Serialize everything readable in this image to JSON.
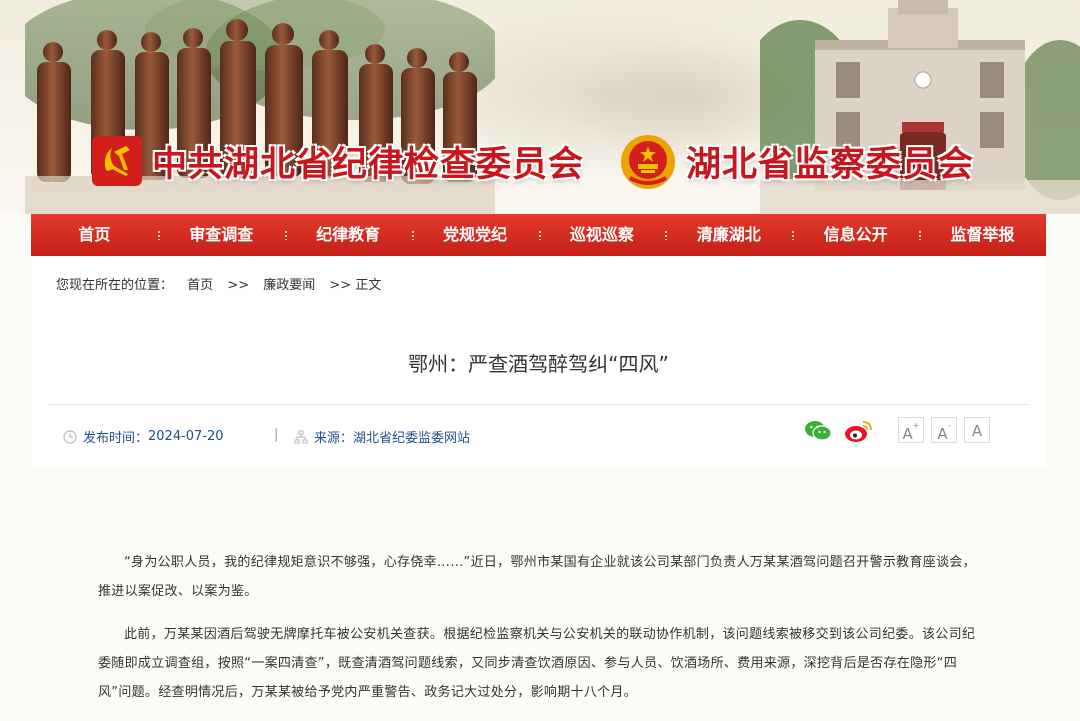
{
  "banner": {
    "left_title": "中共湖北省纪律检查委员会",
    "right_title": "湖北省监察委员会",
    "colors": {
      "title_red": "#c8161d",
      "gold": "#f2b400"
    }
  },
  "nav": {
    "items": [
      "首页",
      "审查调查",
      "纪律教育",
      "党规党纪",
      "巡视巡察",
      "清廉湖北",
      "信息公开",
      "监督举报"
    ],
    "colors": {
      "bar": "#d52a21"
    }
  },
  "breadcrumb": {
    "prefix": "您现在所在的位置：",
    "items": [
      "首页",
      ">>",
      "廉政要闻",
      ">> 正文"
    ]
  },
  "article": {
    "title": "鄂州：严查酒驾醉驾纠“四风”",
    "publish_label": "发布时间：",
    "publish_date": "2024-07-20",
    "divider": "|",
    "source_label": "来源：",
    "source": "湖北省纪委监委网站",
    "share_icons": [
      "wechat-icon",
      "weibo-icon"
    ],
    "font_buttons": {
      "large": "A",
      "large_sup": "+",
      "small": "A",
      "small_sup": "-",
      "reset": "A"
    },
    "paragraphs": [
      "“身为公职人员，我的纪律规矩意识不够强，心存侥幸……”近日，鄂州市某国有企业就该公司某部门负责人万某某酒驾问题召开警示教育座谈会，推进以案促改、以案为鉴。",
      "此前，万某某因酒后驾驶无牌摩托车被公安机关查获。根据纪检监察机关与公安机关的联动协作机制，该问题线索被移交到该公司纪委。该公司纪委随即成立调查组，按照“一案四清查”，既查清酒驾问题线索，又同步清查饮酒原因、参与人员、饮酒场所、费用来源，深挖背后是否存在隐形“四风”问题。经查明情况后，万某某被给予党内严重警告、政务记大过处分，影响期十八个月。"
    ]
  }
}
